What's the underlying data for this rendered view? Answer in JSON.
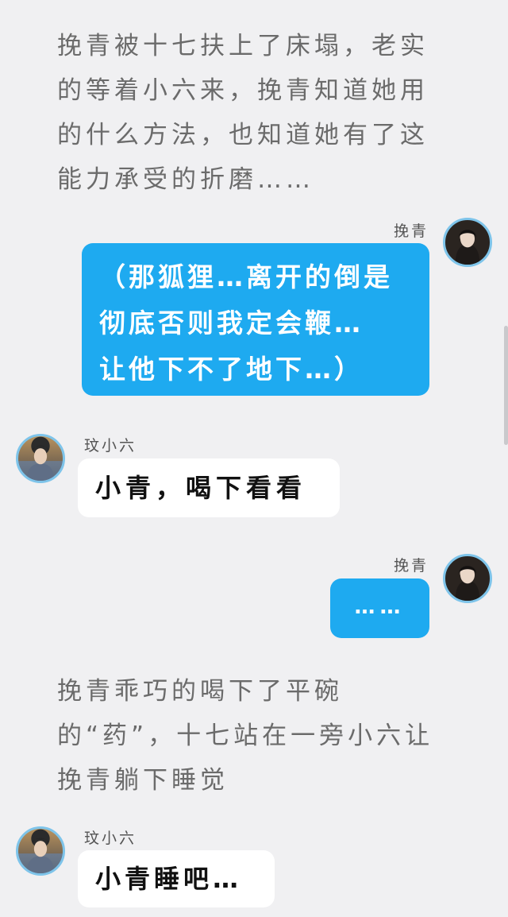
{
  "narration_1": "挽青被十七扶上了床塌，老实的等着小六来，挽青知道她用的什么方法，也知道她有了这能力承受的折磨……",
  "message_1": {
    "sender": "挽青",
    "text": "（那狐狸…离开的倒是\n彻底否则我定会鞭…\n让他下不了地下…）"
  },
  "message_2": {
    "sender": "玟小六",
    "text": "小青，喝下看看"
  },
  "message_3": {
    "sender": "挽青",
    "text": "……"
  },
  "narration_2": "挽青乖巧的喝下了平碗的“药”，十七站在一旁小六让挽青躺下睡觉",
  "message_4": {
    "sender": "玟小六",
    "text": "小青睡吧…"
  },
  "colors": {
    "background": "#f0f0f2",
    "blue_bubble": "#1eaaf0",
    "white_bubble": "#ffffff",
    "avatar_ring": "#7ec4ea",
    "narration_text": "#6b6b6b"
  }
}
